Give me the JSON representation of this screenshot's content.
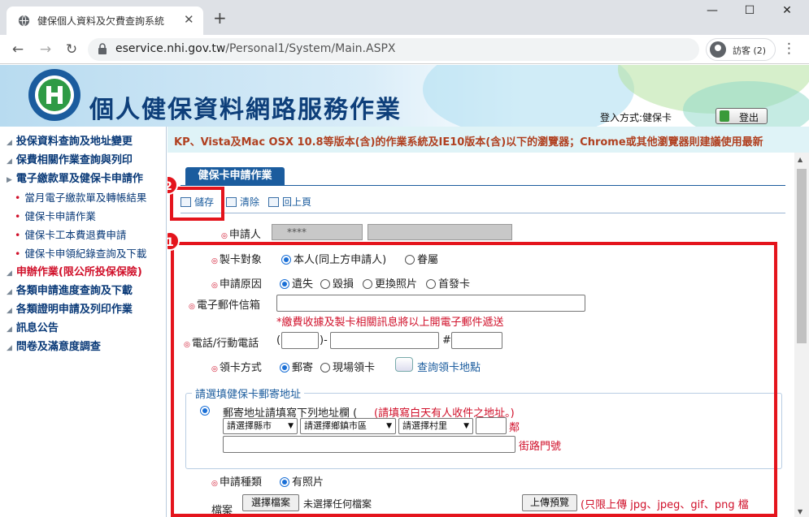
{
  "browser": {
    "tab_title": "健保個人資料及欠費查詢系統",
    "tab_close": "✕",
    "new_tab": "+",
    "window_controls": [
      "—",
      "☐",
      "✕"
    ],
    "url_host": "eservice.nhi.gov.tw",
    "url_path": "/Personal1/System/Main.ASPX",
    "profile_label": "訪客 (2)",
    "menu": "⋮",
    "back": "←",
    "forward": "→",
    "reload": "↻"
  },
  "header": {
    "site_title": "個人健保資料網路服務作業",
    "login_type": "登入方式:健保卡",
    "logout": "登出"
  },
  "sidebar": {
    "items": [
      {
        "label": "投保資料查詢及地址變更"
      },
      {
        "label": "保費相關作業查詢與列印"
      },
      {
        "label": "電子繳款單及健保卡申請作"
      },
      {
        "label": "申辦作業(限公所投保保險)"
      },
      {
        "label": "各類申請進度查詢及下載"
      },
      {
        "label": "各類證明申請及列印作業"
      },
      {
        "label": "訊息公告"
      },
      {
        "label": "問卷及滿意度調查"
      }
    ],
    "subitems": [
      {
        "label": "當月電子繳款單及轉帳結果"
      },
      {
        "label": "健保卡申請作業"
      },
      {
        "label": "健保卡工本費退費申請"
      },
      {
        "label": "健保卡申領紀錄查詢及下載"
      }
    ]
  },
  "main": {
    "marquee": "KP、Vista及Mac OSX 10.8等版本(含)的作業系統及IE10版本(含)以下的瀏覽器；Chrome或其他瀏覽器則建議使用最新",
    "section_title": "健保卡申請作業",
    "actions": {
      "save": "儲存",
      "clear": "清除",
      "back": "回上頁"
    },
    "applicant": {
      "label": "申請人",
      "masked": "****"
    },
    "card_target": {
      "label": "製卡對象",
      "options": [
        "本人(同上方申請人)",
        "眷屬"
      ],
      "selected": "本人(同上方申請人)"
    },
    "reason": {
      "label": "申請原因",
      "options": [
        "遺失",
        "毀損",
        "更換照片",
        "首發卡"
      ],
      "selected": "遺失"
    },
    "email": {
      "label": "電子郵件信箱",
      "note": "*繳費收據及製卡相關訊息將以上開電子郵件遞送"
    },
    "phone": {
      "label": "電話/行動電話",
      "open_paren": "(",
      "close_dash": ")-",
      "ext": "#"
    },
    "pickup": {
      "label": "領卡方式",
      "options": [
        "郵寄",
        "現場領卡"
      ],
      "selected": "郵寄",
      "query_link": "查詢領卡地點"
    },
    "address": {
      "legend": "請選填健保卡郵寄地址",
      "instruction": "郵寄地址請填寫下列地址欄",
      "instruction_note": "(請填寫白天有人收件之地址。)",
      "open_paren": "(",
      "selects": [
        "請選擇縣市",
        "請選擇鄉鎮市區",
        "請選擇村里"
      ],
      "neighborhood": "鄰",
      "street": "街路門號"
    },
    "apply_type": {
      "label": "申請種類",
      "option": "有照片"
    },
    "file": {
      "label": "檔案",
      "choose": "選擇檔案",
      "none": "未選擇任何檔案",
      "upload": "上傳預覽",
      "note": "(只限上傳 jpg、jpeg、gif、png 檔"
    },
    "badges": [
      "1",
      "2"
    ]
  },
  "colors": {
    "accent": "#1b5c9e",
    "highlight": "#e4141c",
    "required": "#d0102a"
  }
}
